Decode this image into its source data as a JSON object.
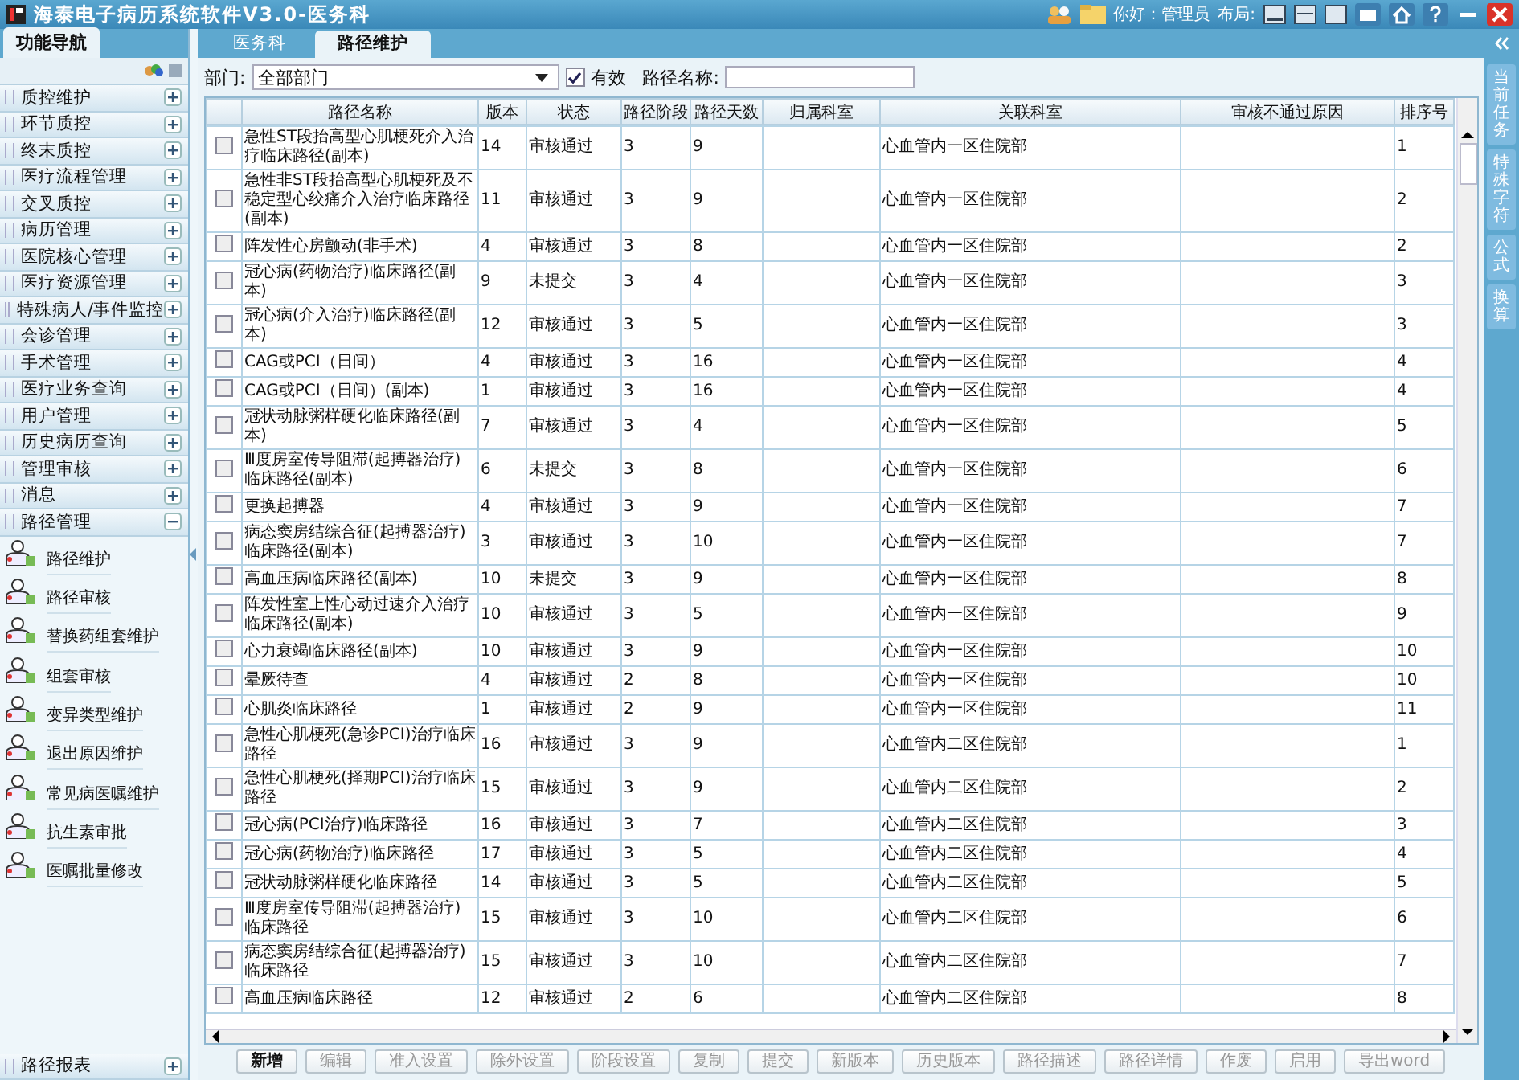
{
  "window": {
    "title": "海泰电子病历系统软件V3.0-医务科",
    "greeting": "你好：管理员",
    "layout_label": "布局:"
  },
  "sidebar": {
    "tab": "功能导航",
    "groups": [
      {
        "label": "质控维护",
        "expanded": false
      },
      {
        "label": "环节质控",
        "expanded": false
      },
      {
        "label": "终末质控",
        "expanded": false
      },
      {
        "label": "医疗流程管理",
        "expanded": false
      },
      {
        "label": "交叉质控",
        "expanded": false
      },
      {
        "label": "病历管理",
        "expanded": false
      },
      {
        "label": "医院核心管理",
        "expanded": false
      },
      {
        "label": "医疗资源管理",
        "expanded": false
      },
      {
        "label": "特殊病人/事件监控",
        "expanded": false
      },
      {
        "label": "会诊管理",
        "expanded": false
      },
      {
        "label": "手术管理",
        "expanded": false
      },
      {
        "label": "医疗业务查询",
        "expanded": false
      },
      {
        "label": "用户管理",
        "expanded": false
      },
      {
        "label": "历史病历查询",
        "expanded": false
      },
      {
        "label": "管理审核",
        "expanded": false
      },
      {
        "label": "消息",
        "expanded": false
      },
      {
        "label": "路径管理",
        "expanded": true,
        "children": [
          "路径维护",
          "路径审核",
          "替换药组套维护",
          "组套审核",
          "变异类型维护",
          "退出原因维护",
          "常见病医嘱维护",
          "抗生素审批",
          "医嘱批量修改"
        ]
      }
    ],
    "footer_group": {
      "label": "路径报表",
      "expanded": false
    }
  },
  "tabs": [
    {
      "label": "医务科",
      "selected": false
    },
    {
      "label": "路径维护",
      "selected": true
    }
  ],
  "filter": {
    "dept_label": "部门:",
    "dept_value": "全部部门",
    "valid_label": "有效",
    "valid_checked": true,
    "name_label": "路径名称:"
  },
  "table": {
    "columns": [
      "路径名称",
      "版本",
      "状态",
      "路径阶段",
      "路径天数",
      "归属科室",
      "关联科室",
      "审核不通过原因",
      "排序号"
    ],
    "rows": [
      {
        "checked": false,
        "name": "急性ST段抬高型心肌梗死介入治疗临床路径(副本)",
        "version": "14",
        "status": "审核通过",
        "stage": "3",
        "days": "9",
        "linked": "心血管内一区住院部",
        "order": "1"
      },
      {
        "checked": false,
        "name": "急性非ST段抬高型心肌梗死及不稳定型心绞痛介入治疗临床路径(副本)",
        "version": "11",
        "status": "审核通过",
        "stage": "3",
        "days": "9",
        "linked": "心血管内一区住院部",
        "order": "2"
      },
      {
        "checked": false,
        "name": "阵发性心房颤动(非手术)",
        "version": "4",
        "status": "审核通过",
        "stage": "3",
        "days": "8",
        "linked": "心血管内一区住院部",
        "order": "2"
      },
      {
        "checked": false,
        "name": "冠心病(药物治疗)临床路径(副本)",
        "version": "9",
        "status": "未提交",
        "stage": "3",
        "days": "4",
        "linked": "心血管内一区住院部",
        "order": "3"
      },
      {
        "checked": false,
        "name": "冠心病(介入治疗)临床路径(副本)",
        "version": "12",
        "status": "审核通过",
        "stage": "3",
        "days": "5",
        "linked": "心血管内一区住院部",
        "order": "3"
      },
      {
        "checked": false,
        "name": "CAG或PCI（日间）",
        "version": "4",
        "status": "审核通过",
        "stage": "3",
        "days": "16",
        "linked": "心血管内一区住院部",
        "order": "4"
      },
      {
        "checked": false,
        "name": "CAG或PCI（日间）(副本)",
        "version": "1",
        "status": "审核通过",
        "stage": "3",
        "days": "16",
        "linked": "心血管内一区住院部",
        "order": "4"
      },
      {
        "checked": false,
        "name": "冠状动脉粥样硬化临床路径(副本)",
        "version": "7",
        "status": "审核通过",
        "stage": "3",
        "days": "4",
        "linked": "心血管内一区住院部",
        "order": "5"
      },
      {
        "checked": false,
        "name": "Ⅲ度房室传导阻滞(起搏器治疗)临床路径(副本)",
        "version": "6",
        "status": "未提交",
        "stage": "3",
        "days": "8",
        "linked": "心血管内一区住院部",
        "order": "6"
      },
      {
        "checked": false,
        "name": "更换起搏器",
        "version": "4",
        "status": "审核通过",
        "stage": "3",
        "days": "9",
        "linked": "心血管内一区住院部",
        "order": "7"
      },
      {
        "checked": false,
        "name": "病态窦房结综合征(起搏器治疗)临床路径(副本)",
        "version": "3",
        "status": "审核通过",
        "stage": "3",
        "days": "10",
        "linked": "心血管内一区住院部",
        "order": "7"
      },
      {
        "checked": false,
        "name": "高血压病临床路径(副本)",
        "version": "10",
        "status": "未提交",
        "stage": "3",
        "days": "9",
        "linked": "心血管内一区住院部",
        "order": "8"
      },
      {
        "checked": false,
        "name": "阵发性室上性心动过速介入治疗临床路径(副本)",
        "version": "10",
        "status": "审核通过",
        "stage": "3",
        "days": "5",
        "linked": "心血管内一区住院部",
        "order": "9"
      },
      {
        "checked": false,
        "name": "心力衰竭临床路径(副本)",
        "version": "10",
        "status": "审核通过",
        "stage": "3",
        "days": "9",
        "linked": "心血管内一区住院部",
        "order": "10"
      },
      {
        "checked": false,
        "name": "晕厥待查",
        "version": "4",
        "status": "审核通过",
        "stage": "2",
        "days": "8",
        "linked": "心血管内一区住院部",
        "order": "10"
      },
      {
        "checked": false,
        "name": "心肌炎临床路径",
        "version": "1",
        "status": "审核通过",
        "stage": "2",
        "days": "9",
        "linked": "心血管内一区住院部",
        "order": "11"
      },
      {
        "checked": false,
        "name": "急性心肌梗死(急诊PCI)治疗临床路径",
        "version": "16",
        "status": "审核通过",
        "stage": "3",
        "days": "9",
        "linked": "心血管内二区住院部",
        "order": "1"
      },
      {
        "checked": false,
        "name": "急性心肌梗死(择期PCI)治疗临床路径",
        "version": "15",
        "status": "审核通过",
        "stage": "3",
        "days": "9",
        "linked": "心血管内二区住院部",
        "order": "2"
      },
      {
        "checked": false,
        "name": "冠心病(PCI治疗)临床路径",
        "version": "16",
        "status": "审核通过",
        "stage": "3",
        "days": "7",
        "linked": "心血管内二区住院部",
        "order": "3"
      },
      {
        "checked": false,
        "name": "冠心病(药物治疗)临床路径",
        "version": "17",
        "status": "审核通过",
        "stage": "3",
        "days": "5",
        "linked": "心血管内二区住院部",
        "order": "4"
      },
      {
        "checked": false,
        "name": "冠状动脉粥样硬化临床路径",
        "version": "14",
        "status": "审核通过",
        "stage": "3",
        "days": "5",
        "linked": "心血管内二区住院部",
        "order": "5"
      },
      {
        "checked": false,
        "name": "Ⅲ度房室传导阻滞(起搏器治疗)临床路径",
        "version": "15",
        "status": "审核通过",
        "stage": "3",
        "days": "10",
        "linked": "心血管内二区住院部",
        "order": "6"
      },
      {
        "checked": false,
        "name": "病态窦房结综合征(起搏器治疗)临床路径",
        "version": "15",
        "status": "审核通过",
        "stage": "3",
        "days": "10",
        "linked": "心血管内二区住院部",
        "order": "7"
      },
      {
        "checked": false,
        "name": "高血压病临床路径",
        "version": "12",
        "status": "审核通过",
        "stage": "2",
        "days": "6",
        "linked": "心血管内二区住院部",
        "order": "8"
      }
    ]
  },
  "buttons": [
    {
      "label": "新增",
      "disabled": false
    },
    {
      "label": "编辑",
      "disabled": true
    },
    {
      "label": "准入设置",
      "disabled": true
    },
    {
      "label": "除外设置",
      "disabled": true
    },
    {
      "label": "阶段设置",
      "disabled": true
    },
    {
      "label": "复制",
      "disabled": true
    },
    {
      "label": "提交",
      "disabled": true
    },
    {
      "label": "新版本",
      "disabled": true
    },
    {
      "label": "历史版本",
      "disabled": true
    },
    {
      "label": "路径描述",
      "disabled": true
    },
    {
      "label": "路径详情",
      "disabled": true
    },
    {
      "label": "作废",
      "disabled": true
    },
    {
      "label": "启用",
      "disabled": true
    },
    {
      "label": "导出word",
      "disabled": true
    }
  ],
  "right_panel": [
    "当前任务",
    "特殊字符",
    "公式",
    "换算"
  ]
}
